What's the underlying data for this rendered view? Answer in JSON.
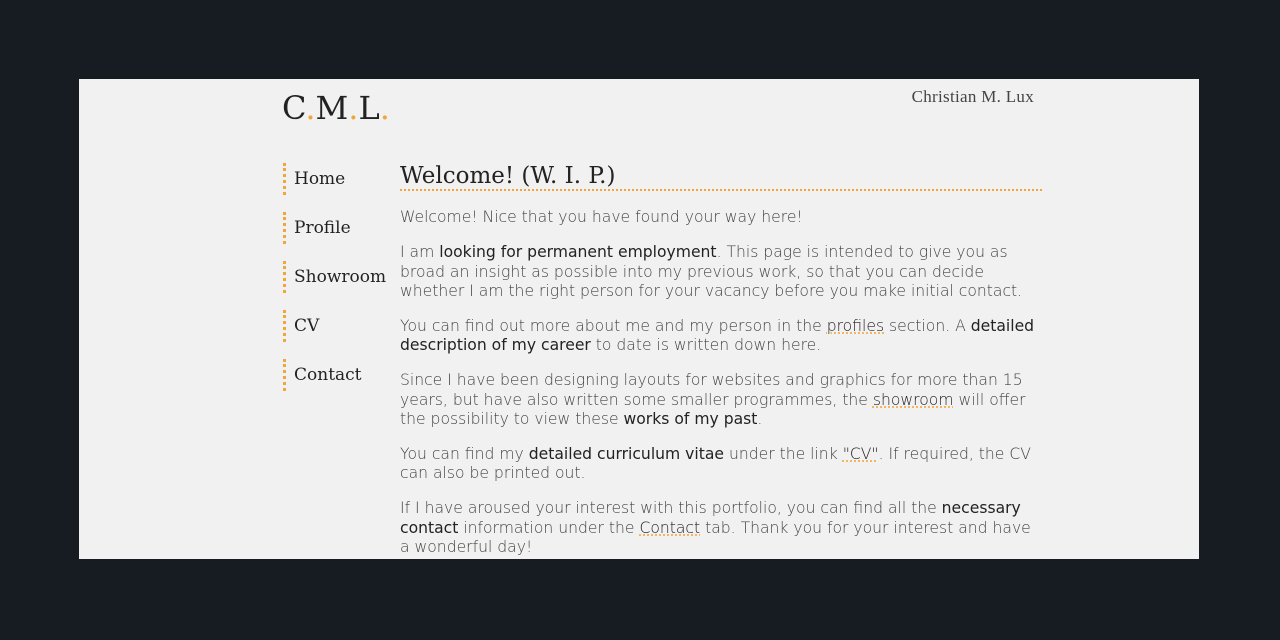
{
  "header": {
    "logo": {
      "c": "C",
      "m": "M",
      "l": "L",
      "dot": "."
    },
    "author": "Christian M. Lux"
  },
  "nav": {
    "items": [
      {
        "label": "Home"
      },
      {
        "label": "Profile"
      },
      {
        "label": "Showroom"
      },
      {
        "label": "CV"
      },
      {
        "label": "Contact"
      }
    ]
  },
  "main": {
    "title": "Welcome! (W. I. P.)",
    "p1": "Welcome! Nice that you have found your way here!",
    "p2": {
      "t1": "I am ",
      "b1": "looking for permanent employment",
      "t2": ". This page is intended to give you as broad an insight as possible into my previous work, so that you can decide whether I am the right person for your vacancy before you make initial contact."
    },
    "p3": {
      "t1": "You can find out more about me and my person in the ",
      "l1": "profiles",
      "t2": " section. A ",
      "b1": "detailed description of my career",
      "t3": " to date is written down here."
    },
    "p4": {
      "t1": "Since I have been designing layouts for websites and graphics for more than 15 years, but have also written some smaller programmes, the ",
      "l1": "showroom",
      "t2": " will offer the possibility to view these ",
      "b1": "works of my past",
      "t3": "."
    },
    "p5": {
      "t1": "You can find my ",
      "b1": "detailed curriculum vitae",
      "t2": " under the link ",
      "l1": "\"CV\"",
      "t3": ". If required, the CV can also be printed out."
    },
    "p6": {
      "t1": "If I have aroused your interest with this portfolio, you can find all the ",
      "b1": "necessary contact",
      "t2": " information under the ",
      "l1": "Contact",
      "t3": " tab. Thank you for your interest and have a wonderful day!"
    }
  },
  "colors": {
    "background": "#171b22",
    "page": "#f1f1f1",
    "accent": "#f0a63a",
    "text": "#444444",
    "heading": "#222222"
  }
}
